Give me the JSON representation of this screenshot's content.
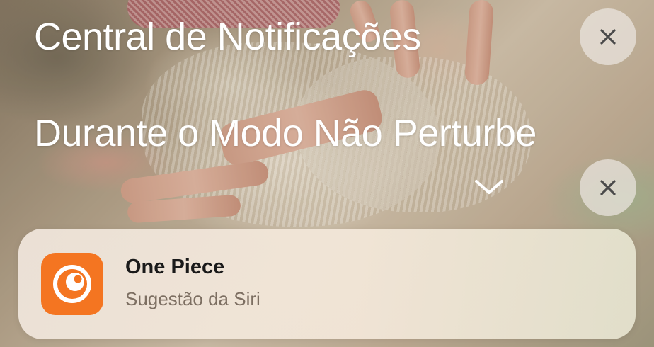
{
  "sections": [
    {
      "title": "Central de Notificações",
      "clear_icon": "close-icon"
    },
    {
      "title": "Durante o Modo Não Perturbe",
      "collapse_icon": "chevron-down-icon",
      "clear_icon": "close-icon"
    }
  ],
  "notification": {
    "app_icon": "crunchyroll-icon",
    "title": "One Piece",
    "subtitle": "Sugestão da Siri",
    "accent_color": "#f47521"
  }
}
